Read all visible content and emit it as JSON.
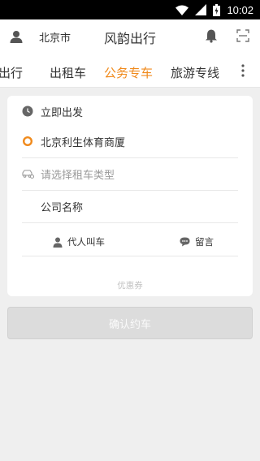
{
  "status_bar": {
    "time": "10:02",
    "icons": [
      "wifi-icon",
      "signal-icon",
      "battery-icon"
    ]
  },
  "header": {
    "city": "北京市",
    "title": "风韵出行",
    "icons": [
      "user-icon",
      "bell-icon",
      "scan-icon"
    ]
  },
  "tabs": [
    {
      "label": "出行"
    },
    {
      "label": "出租车"
    },
    {
      "label": "公务专车",
      "active": true
    },
    {
      "label": "旅游专线"
    }
  ],
  "form": {
    "depart_time": "立即出发",
    "start_location": "北京利生体育商厦",
    "car_type_placeholder": "请选择租车类型",
    "company_name": "公司名称",
    "proxy_call": "代人叫车",
    "message": "留言",
    "coupon": "优惠券"
  },
  "confirm_button": "确认约车",
  "colors": {
    "accent": "#f08a1c",
    "background": "#efefef",
    "disabled": "#dcdcdc"
  }
}
